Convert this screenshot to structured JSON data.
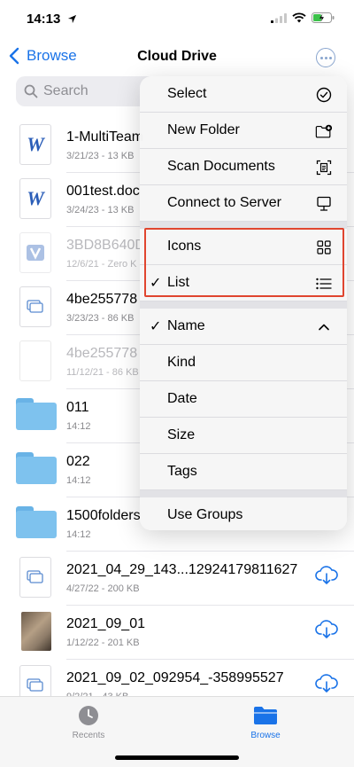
{
  "status_bar": {
    "time": "14:13"
  },
  "nav": {
    "back_label": "Browse",
    "title": "Cloud Drive"
  },
  "search": {
    "placeholder": "Search"
  },
  "files": [
    {
      "name": "1-MultiTeam",
      "meta": "3/21/23 - 13 KB",
      "kind": "word",
      "dim": false
    },
    {
      "name": "001test.doc",
      "meta": "3/24/23 - 13 KB",
      "kind": "word",
      "dim": false
    },
    {
      "name": "3BD8B640D",
      "meta": "12/6/21 - Zero K",
      "kind": "v-doc",
      "dim": true
    },
    {
      "name": "4be255778",
      "meta": "3/23/23 - 86 KB",
      "kind": "doc",
      "dim": false
    },
    {
      "name": "4be255778",
      "meta": "11/12/21 - 86 KB",
      "kind": "blank",
      "dim": true
    },
    {
      "name": "011",
      "meta": "14:12",
      "kind": "folder",
      "dim": false
    },
    {
      "name": "022",
      "meta": "14:12",
      "kind": "folder",
      "dim": false
    },
    {
      "name": "1500folders",
      "meta": "14:12",
      "kind": "folder",
      "dim": false
    },
    {
      "name": "2021_04_29_143...12924179811627",
      "meta": "4/27/22 - 200 KB",
      "kind": "doc",
      "dim": false,
      "cloud": true
    },
    {
      "name": "2021_09_01",
      "meta": "1/12/22 - 201 KB",
      "kind": "photo",
      "dim": false,
      "cloud": true
    },
    {
      "name": "2021_09_02_092954_-358995527",
      "meta": "9/2/21 - 43 KB",
      "kind": "doc",
      "dim": false,
      "cloud": true
    }
  ],
  "menu": {
    "select": "Select",
    "new_folder": "New Folder",
    "scan_documents": "Scan Documents",
    "connect_to_server": "Connect to Server",
    "icons": "Icons",
    "list": "List",
    "name": "Name",
    "kind": "Kind",
    "date": "Date",
    "size": "Size",
    "tags": "Tags",
    "use_groups": "Use Groups",
    "checkmark": "✓"
  },
  "tabs": {
    "recents": "Recents",
    "browse": "Browse"
  },
  "colors": {
    "accent": "#1a73e8",
    "highlight": "#e0452f",
    "folder": "#7ec2ee"
  },
  "icons": {
    "select": "checkmark-circle-icon",
    "new_folder": "folder-plus-icon",
    "scan_documents": "doc-viewfinder-icon",
    "connect_to_server": "desktop-computer-icon",
    "icons": "grid-icon",
    "list": "list-bullet-icon",
    "name": "chevron-up-icon"
  }
}
